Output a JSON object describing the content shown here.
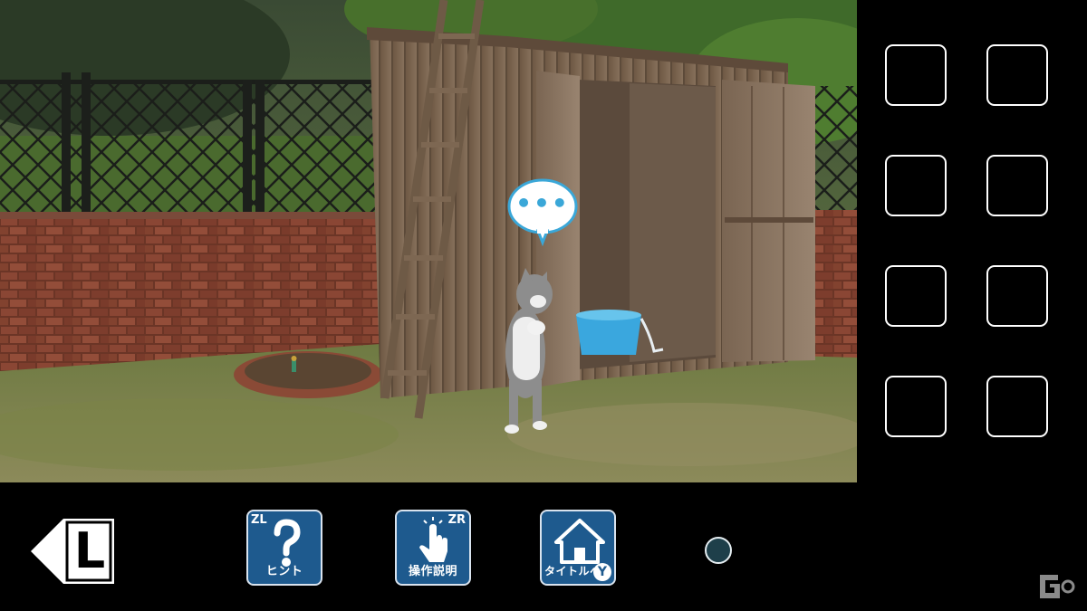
{
  "scene": {
    "description_label": "Backyard with wooden shed, ladder, brick wall and cat",
    "speech_bubble": "•••"
  },
  "inventory": {
    "slots": [
      "",
      "",
      "",
      "",
      "",
      "",
      "",
      ""
    ]
  },
  "bottom_bar": {
    "back_key": "L",
    "hint": {
      "key": "ZL",
      "label": "ヒント"
    },
    "controls": {
      "key": "ZR",
      "label": "操作説明"
    },
    "title": {
      "key": "Y",
      "label": "タイトルへ"
    }
  },
  "colors": {
    "button_blue": "#1e5a8e",
    "bubble_blue": "#3aa7d8",
    "indicator_dot": "#1e3f4a"
  }
}
